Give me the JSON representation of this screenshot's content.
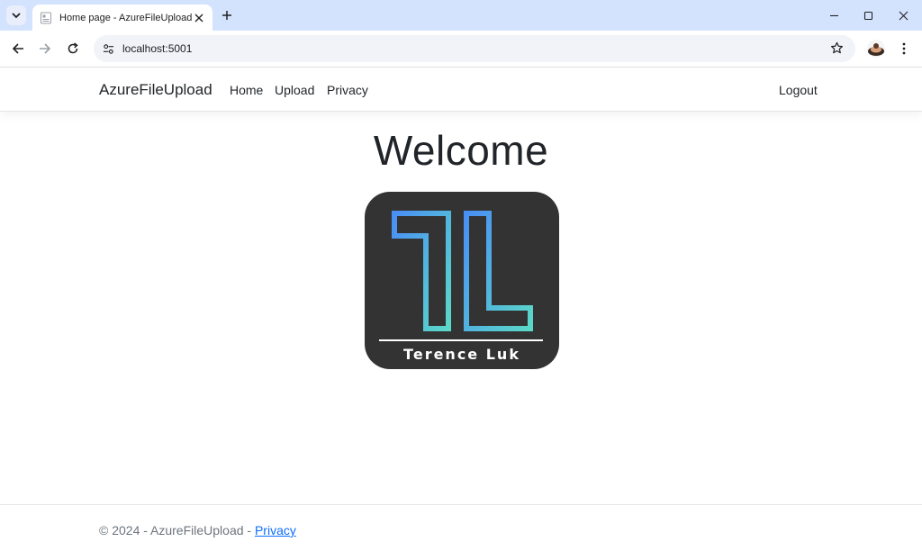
{
  "browser": {
    "tab_title": "Home page - AzureFileUpload",
    "url": "localhost:5001"
  },
  "site": {
    "brand": "AzureFileUpload",
    "nav": {
      "home": "Home",
      "upload": "Upload",
      "privacy": "Privacy",
      "logout": "Logout"
    }
  },
  "main": {
    "heading": "Welcome",
    "logo": {
      "text": "Terence Luk",
      "background": "#333333",
      "gradient_start": "#4a8ff5",
      "gradient_end": "#5ad8c8"
    }
  },
  "footer": {
    "copyright": "© 2024 - AzureFileUpload - ",
    "privacy_link": "Privacy"
  },
  "colors": {
    "chrome_bg": "#d3e3fd",
    "link": "#0d6efd",
    "muted_text": "#6c757d"
  }
}
